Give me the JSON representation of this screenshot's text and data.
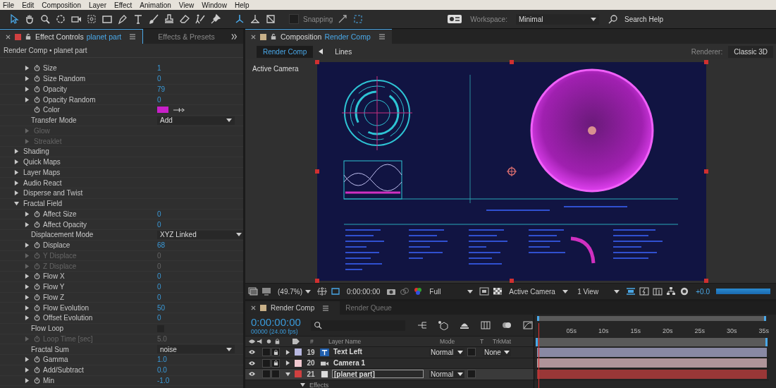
{
  "menu": [
    "File",
    "Edit",
    "Composition",
    "Layer",
    "Effect",
    "Animation",
    "View",
    "Window",
    "Help"
  ],
  "toolbar": {
    "snapping": {
      "label": "Snapping",
      "checked": false
    },
    "workspace_label": "Workspace:",
    "workspace": "Minimal",
    "search": "Search Help"
  },
  "effect_controls": {
    "tabs": [
      {
        "title": "Effect Controls",
        "subject": "planet part",
        "color": "#d04040",
        "selected": true
      },
      {
        "title": "Effects & Presets",
        "selected": false
      }
    ],
    "breadcrumb": "Render Comp • planet part",
    "rows": [
      {
        "kind": "param",
        "label": "Size",
        "value": "1",
        "disabled": false
      },
      {
        "kind": "param",
        "label": "Size Random",
        "value": "0",
        "disabled": false
      },
      {
        "kind": "param",
        "label": "Opacity",
        "value": "79",
        "disabled": false
      },
      {
        "kind": "param",
        "label": "Opacity Random",
        "value": "0",
        "disabled": false
      },
      {
        "kind": "color",
        "label": "Color",
        "color": "#c820c8",
        "disabled": false
      },
      {
        "kind": "dropdown",
        "label": "Transfer Mode",
        "value": "Add",
        "disabled": false
      },
      {
        "kind": "subgroup",
        "label": "Glow",
        "disabled": true
      },
      {
        "kind": "subgroup",
        "label": "Streaklet",
        "disabled": true
      }
    ],
    "groups": [
      {
        "label": "Shading",
        "expanded": false
      },
      {
        "label": "Quick Maps",
        "expanded": false
      },
      {
        "label": "Layer Maps",
        "expanded": false
      },
      {
        "label": "Audio React",
        "expanded": false
      },
      {
        "label": "Disperse and Twist",
        "expanded": false
      },
      {
        "label": "Fractal Field",
        "expanded": true,
        "children": [
          {
            "kind": "param",
            "label": "Affect Size",
            "value": "0",
            "disabled": false
          },
          {
            "kind": "param",
            "label": "Affect Opacity",
            "value": "0",
            "disabled": false
          },
          {
            "kind": "dropdown",
            "label": "Displacement Mode",
            "value": "XYZ Linked",
            "disabled": false
          },
          {
            "kind": "param",
            "label": "Displace",
            "value": "68",
            "disabled": false
          },
          {
            "kind": "param",
            "label": "Y Displace",
            "value": "0",
            "disabled": true
          },
          {
            "kind": "param",
            "label": "Z Displace",
            "value": "0",
            "disabled": true
          },
          {
            "kind": "param",
            "label": "Flow X",
            "value": "0",
            "disabled": false
          },
          {
            "kind": "param",
            "label": "Flow Y",
            "value": "0",
            "disabled": false
          },
          {
            "kind": "param",
            "label": "Flow Z",
            "value": "0",
            "disabled": false
          },
          {
            "kind": "param",
            "label": "Flow Evolution",
            "value": "50",
            "disabled": false
          },
          {
            "kind": "param",
            "label": "Offset Evolution",
            "value": "0",
            "disabled": false
          },
          {
            "kind": "checkbox",
            "label": "Flow Loop",
            "checked": false,
            "disabled": false
          },
          {
            "kind": "param",
            "label": "Loop Time [sec]",
            "value": "5.0",
            "disabled": true
          },
          {
            "kind": "dropdown",
            "label": "Fractal Sum",
            "value": "noise",
            "disabled": false
          },
          {
            "kind": "param",
            "label": "Gamma",
            "value": "1.0",
            "disabled": false
          },
          {
            "kind": "param",
            "label": "Add/Subtract",
            "value": "0.0",
            "disabled": false
          },
          {
            "kind": "param",
            "label": "Min",
            "value": "-1.0",
            "disabled": false
          }
        ]
      }
    ]
  },
  "composition": {
    "title": "Composition",
    "subject": "Render Comp",
    "color": "#c8b088",
    "nav": [
      {
        "label": "Render Comp",
        "selected": true
      },
      {
        "label": "Lines",
        "selected": false
      }
    ],
    "renderer_label": "Renderer:",
    "renderer": "Classic 3D",
    "view_label": "Active Camera",
    "viewer_bar": {
      "zoom": "(49.7%)",
      "timecode": "0:00:00:00",
      "resolution": "Full",
      "camera": "Active Camera",
      "views": "1 View",
      "exposure": "+0.0",
      "render_progress": {
        "level": 1
      }
    }
  },
  "timeline": {
    "tabs": [
      {
        "label": "Render Comp",
        "color": "#c8b088",
        "selected": true
      },
      {
        "label": "Render Queue",
        "selected": false
      }
    ],
    "timecode": "0:00:00:00",
    "frame": "00000 (24.00 fps)",
    "columns": [
      "#",
      "Layer Name",
      "Mode",
      "T",
      "TrkMat"
    ],
    "ticks": [
      "05s",
      "10s",
      "15s",
      "20s",
      "25s",
      "30s",
      "35s"
    ],
    "layers": [
      {
        "kind": "text",
        "number": "19",
        "name": "Text Left",
        "color": "#b8b8e0",
        "mode": "Normal",
        "trkmat": "None",
        "locked": true,
        "expanded": false,
        "selected": false
      },
      {
        "kind": "camera",
        "number": "20",
        "name": "Camera 1",
        "color": "#f0c8d0",
        "locked": true,
        "expanded": false,
        "selected": false
      },
      {
        "kind": "solid",
        "number": "21",
        "name": "[planet part]",
        "color": "#d04040",
        "mode": "Normal",
        "locked": false,
        "expanded": true,
        "selected": true
      }
    ],
    "sub_row": "Effects"
  }
}
